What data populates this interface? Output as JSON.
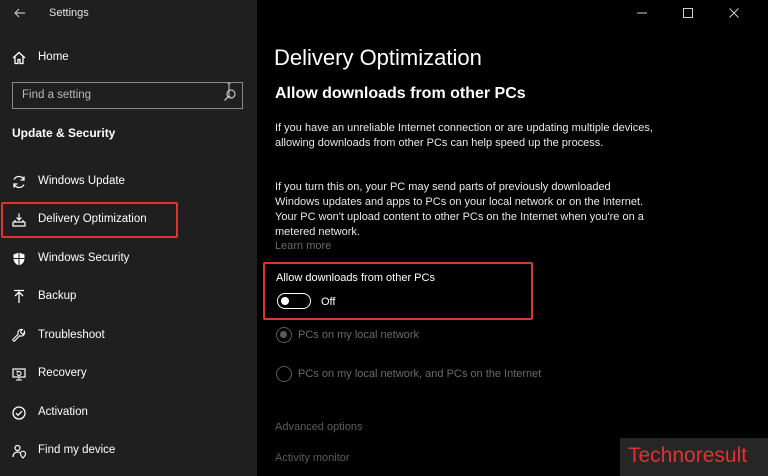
{
  "app": {
    "title": "Settings"
  },
  "sidebar": {
    "home": "Home",
    "search_placeholder": "Find a setting",
    "section": "Update & Security",
    "items": [
      {
        "label": "Windows Update",
        "icon": "refresh-icon"
      },
      {
        "label": "Delivery Optimization",
        "icon": "delivery-icon"
      },
      {
        "label": "Windows Security",
        "icon": "shield-icon"
      },
      {
        "label": "Backup",
        "icon": "backup-arrow-icon"
      },
      {
        "label": "Troubleshoot",
        "icon": "wrench-icon"
      },
      {
        "label": "Recovery",
        "icon": "recovery-icon"
      },
      {
        "label": "Activation",
        "icon": "check-circle-icon"
      },
      {
        "label": "Find my device",
        "icon": "person-pin-icon"
      }
    ]
  },
  "main": {
    "title": "Delivery Optimization",
    "subtitle": "Allow downloads from other PCs",
    "para1": "If you have an unreliable Internet connection or are updating multiple devices, allowing downloads from other PCs can help speed up the process.",
    "para2": "If you turn this on, your PC may send parts of previously downloaded Windows updates and apps to PCs on your local network or on the Internet. Your PC won't upload content to other PCs on the Internet when you're on a metered network.",
    "learn_more": "Learn more",
    "toggle_label": "Allow downloads from other PCs",
    "toggle_state": "Off",
    "radio1": "PCs on my local network",
    "radio2": "PCs on my local network, and PCs on the Internet",
    "advanced": "Advanced options",
    "activity": "Activity monitor"
  },
  "watermark": "Technoresult",
  "colors": {
    "highlight": "#e0322f",
    "sidebar_bg": "#1f1f1f",
    "content_bg": "#000000"
  }
}
